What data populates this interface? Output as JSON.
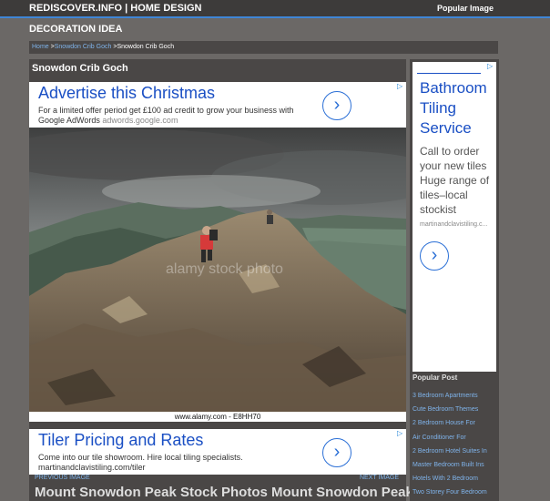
{
  "header": {
    "site_title": "REDISCOVER.INFO | HOME DESIGN",
    "popular_image": "Popular Image"
  },
  "section": {
    "title": "DECORATION IDEA"
  },
  "breadcrumb": {
    "home": "Home",
    "sep1": " >",
    "category": "Snowdon Crib Goch",
    "sep2": " >",
    "current": "Snowdon Crib Goch"
  },
  "post": {
    "title": "Snowdon Crib Goch",
    "bottom_title": "Mount Snowdon Peak Stock Photos Mount Snowdon Peak",
    "photo_caption": "www.alamy.com - E8HH70",
    "watermark": "alamy stock photo"
  },
  "ad_top": {
    "headline": "Advertise this Christmas",
    "line1": "For a limited offer period get £100 ad credit to grow your business with",
    "line2_main": "Google AdWords",
    "line2_url": "adwords.google.com"
  },
  "ad_mid": {
    "headline": "Tiler Pricing and Rates",
    "line1": "Come into our tile showroom. Hire local tiling specialists.",
    "url": "martinandclavistiling.com/tiler"
  },
  "side_ad": {
    "headline": "Bathroom Tiling Service",
    "body": "Call to order your new tiles Huge range of tiles–local stockist",
    "url": "martinandclavistiling.c..."
  },
  "nav": {
    "prev": "PREVIOUS IMAGE",
    "next": "NEXT IMAGE"
  },
  "popular": {
    "heading": "Popular Post",
    "items": [
      "3 Bedroom Apartments",
      "Cute Bedroom Themes",
      "2 Bedroom House For",
      "Air Conditioner For",
      "2 Bedroom Hotel Suites In",
      "Master Bedroom Built Ins",
      "Hotels With 2 Bedroom",
      "Two Storey Four Bedroom"
    ]
  },
  "icons": {
    "ad_arrow": "chevron-right-icon",
    "adchoices": "adchoices-icon"
  },
  "colors": {
    "page_bg": "#6b6866",
    "panel_bg": "#4a4746",
    "topbar_bg": "#3d3b3a",
    "accent_blue": "#3f86d6",
    "link_blue": "#7fb3ea",
    "ad_headline": "#1a4fc4"
  }
}
